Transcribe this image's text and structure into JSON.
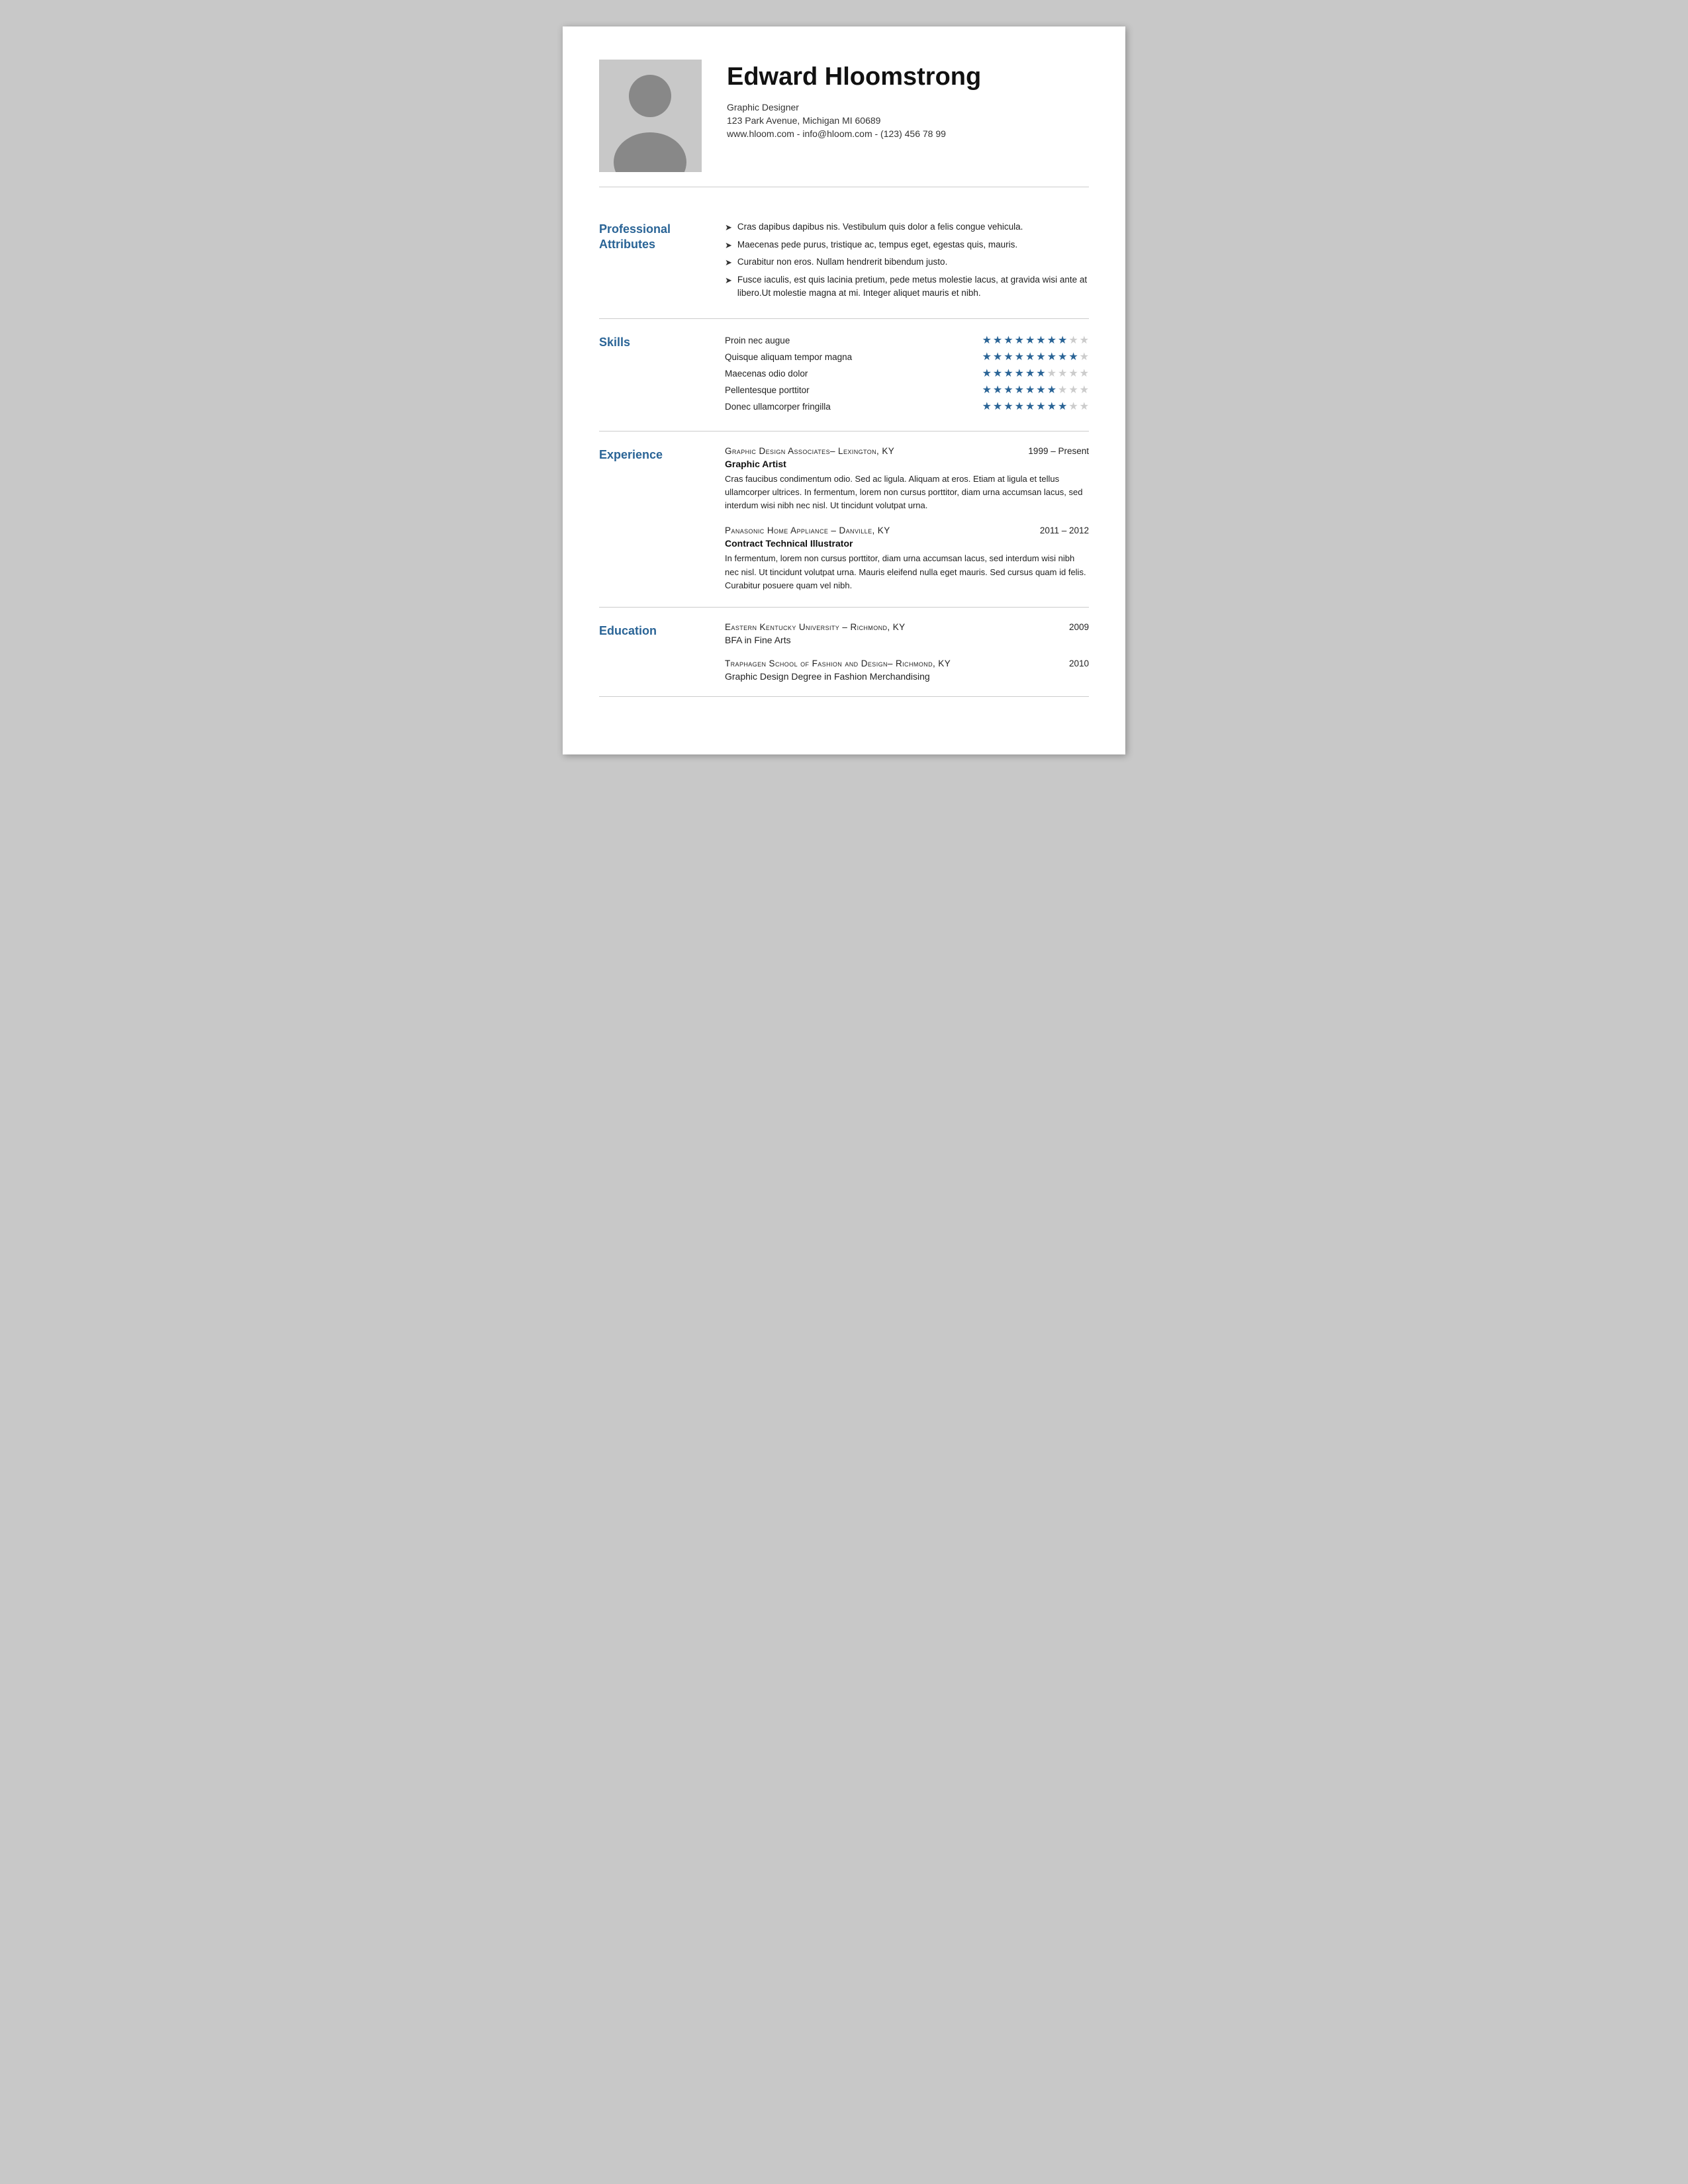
{
  "header": {
    "name": "Edward Hloomstrong",
    "title": "Graphic Designer",
    "address": "123 Park Avenue, Michigan MI 60689",
    "contact": "www.hloom.com - info@hloom.com - (123) 456 78 99"
  },
  "sections": {
    "professional_attributes": {
      "label": "Professional Attributes",
      "items": [
        "Cras dapibus dapibus nis. Vestibulum quis dolor a felis congue vehicula.",
        "Maecenas pede purus, tristique ac, tempus eget, egestas quis, mauris.",
        "Curabitur non eros. Nullam hendrerit bibendum justo.",
        "Fusce iaculis, est quis lacinia pretium, pede metus molestie lacus, at gravida wisi ante at libero.Ut molestie magna at mi. Integer aliquet mauris et nibh."
      ]
    },
    "skills": {
      "label": "Skills",
      "items": [
        {
          "name": "Proin nec augue",
          "stars": 8
        },
        {
          "name": "Quisque aliquam tempor magna",
          "stars": 9
        },
        {
          "name": "Maecenas odio dolor",
          "stars": 6
        },
        {
          "name": "Pellentesque porttitor",
          "stars": 7
        },
        {
          "name": "Donec ullamcorper fringilla",
          "stars": 8
        }
      ],
      "max_stars": 10
    },
    "experience": {
      "label": "Experience",
      "items": [
        {
          "company": "Graphic Design Associates– Lexington, KY",
          "dates": "1999 – Present",
          "role": "Graphic Artist",
          "description": "Cras faucibus condimentum odio. Sed ac ligula. Aliquam at eros. Etiam at ligula et tellus ullamcorper ultrices. In fermentum, lorem non cursus porttitor, diam urna accumsan lacus, sed interdum wisi nibh nec nisl. Ut tincidunt volutpat urna."
        },
        {
          "company": "Panasonic Home Appliance – Danville, KY",
          "dates": "2011 – 2012",
          "role": "Contract Technical Illustrator",
          "description": "In fermentum, lorem non cursus porttitor, diam urna accumsan lacus, sed interdum wisi nibh nec nisl. Ut tincidunt volutpat urna. Mauris eleifend nulla eget mauris. Sed cursus quam id felis. Curabitur posuere quam vel nibh."
        }
      ]
    },
    "education": {
      "label": "Education",
      "items": [
        {
          "school": "Eastern Kentucky University – Richmond, KY",
          "year": "2009",
          "degree": "BFA in Fine Arts"
        },
        {
          "school": "Traphagen School of Fashion and Design– Richmond, KY",
          "year": "2010",
          "degree": "Graphic Design Degree in Fashion Merchandising"
        }
      ]
    }
  }
}
